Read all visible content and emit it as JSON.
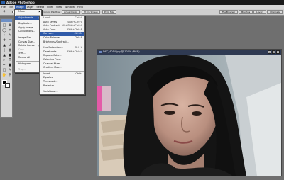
{
  "app": {
    "title": "Adobe Photoshop"
  },
  "menubar": [
    {
      "label": "File"
    },
    {
      "label": "Edit"
    },
    {
      "label": "Image"
    },
    {
      "label": "Layer"
    },
    {
      "label": "Select"
    },
    {
      "label": "Filter"
    },
    {
      "label": "View"
    },
    {
      "label": "Window"
    },
    {
      "label": "Help"
    }
  ],
  "options_bar": {
    "buttons": [
      "Actual Pixels",
      "Fit On Screen",
      "Print Size"
    ],
    "checkbox_labels": [
      "Resize Windows To Fit",
      "Ignore Palettes"
    ]
  },
  "palette_tabs": [
    "File Browser",
    "Brushes",
    "Layers",
    "Channels"
  ],
  "image_menu": [
    {
      "label": "Mode",
      "submenu": true
    },
    {
      "sep": true
    },
    {
      "label": "Adjustments",
      "submenu": true,
      "highlighted": true
    },
    {
      "sep": true
    },
    {
      "label": "Duplicate..."
    },
    {
      "label": "Apply Image..."
    },
    {
      "label": "Calculations..."
    },
    {
      "sep": true
    },
    {
      "label": "Image Size..."
    },
    {
      "label": "Canvas Size..."
    },
    {
      "label": "Rotate Canvas",
      "submenu": true
    },
    {
      "label": "Crop",
      "disabled": true
    },
    {
      "label": "Trim..."
    },
    {
      "label": "Reveal All"
    },
    {
      "sep": true
    },
    {
      "label": "Histogram..."
    },
    {
      "sep": true
    },
    {
      "label": "Trap...",
      "disabled": true
    }
  ],
  "adjustments_menu": [
    {
      "label": "Levels...",
      "shortcut": "Ctrl+L"
    },
    {
      "label": "Auto Levels",
      "shortcut": "Shift+Ctrl+L"
    },
    {
      "label": "Auto Contrast",
      "shortcut": "Alt+Shift+Ctrl+L"
    },
    {
      "label": "Auto Color",
      "shortcut": "Shift+Ctrl+B"
    },
    {
      "label": "Curves...",
      "shortcut": "Ctrl+M",
      "highlighted": true
    },
    {
      "label": "Color Balance...",
      "shortcut": "Ctrl+B"
    },
    {
      "label": "Brightness/Contrast..."
    },
    {
      "sep": true
    },
    {
      "label": "Hue/Saturation...",
      "shortcut": "Ctrl+U"
    },
    {
      "label": "Desaturate",
      "shortcut": "Shift+Ctrl+U"
    },
    {
      "label": "Replace Color..."
    },
    {
      "label": "Selective Color..."
    },
    {
      "label": "Channel Mixer..."
    },
    {
      "label": "Gradient Map..."
    },
    {
      "sep": true
    },
    {
      "label": "Invert",
      "shortcut": "Ctrl+I"
    },
    {
      "label": "Equalize"
    },
    {
      "label": "Threshold..."
    },
    {
      "label": "Posterize..."
    },
    {
      "sep": true
    },
    {
      "label": "Variations..."
    }
  ],
  "image_window": {
    "title": "DSC_4054.jpg @ 100% (RGB)"
  },
  "colors": {
    "menu_highlight": "#2f5aa8",
    "workspace": "#6f6f6f",
    "foreground_swatch": "#000000",
    "background_swatch": "#ffffff"
  }
}
